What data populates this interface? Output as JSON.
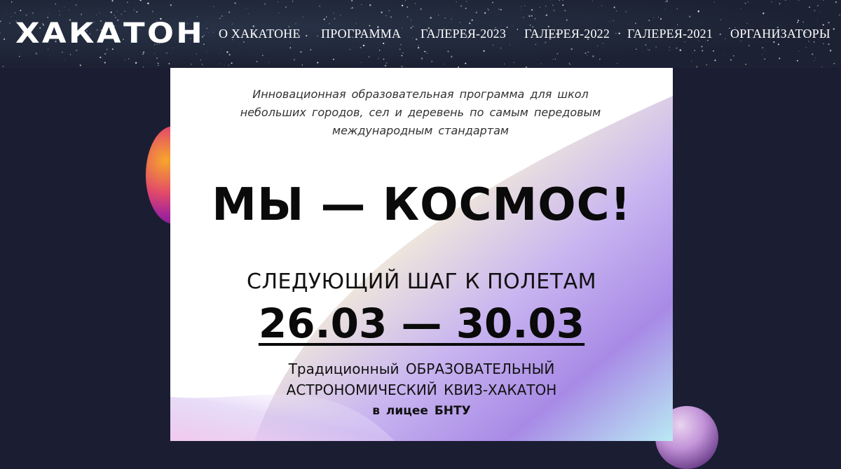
{
  "header": {
    "logo": "ХАКАТОН",
    "nav": [
      {
        "label": "О ХАКАТОНЕ",
        "name": "nav-about"
      },
      {
        "label": "ПРОГРАММА",
        "name": "nav-program"
      },
      {
        "label": "ГАЛЕРЕЯ-2023",
        "name": "nav-gallery-2023"
      },
      {
        "label": "ГАЛЕРЕЯ-2022",
        "name": "nav-gallery-2022"
      },
      {
        "label": "ГАЛЕРЕЯ-2021",
        "name": "nav-gallery-2021"
      },
      {
        "label": "ОРГАНИЗАТОРЫ",
        "name": "nav-organizers"
      }
    ]
  },
  "card": {
    "intro_lines": [
      "Инновационная образовательная программа для школ",
      "небольших городов, сел и деревень по самым передовым",
      "международным стандартам"
    ],
    "headline": "МЫ — КОСМОС!",
    "next_step": "СЛЕДУЮЩИЙ ШАГ К ПОЛЕТАМ",
    "dates": "26.03 — 30.03",
    "desc_line1": "Традиционный ОБРАЗОВАТЕЛЬНЫЙ",
    "desc_line2": "АСТРОНОМИЧЕСКИЙ КВИЗ-ХАКАТОН",
    "desc_line3": "в лицее БНТУ"
  },
  "colors": {
    "page_bg": "#1b1e33",
    "header_bg": "#1c2233",
    "text_dark": "#0a0a0a"
  }
}
